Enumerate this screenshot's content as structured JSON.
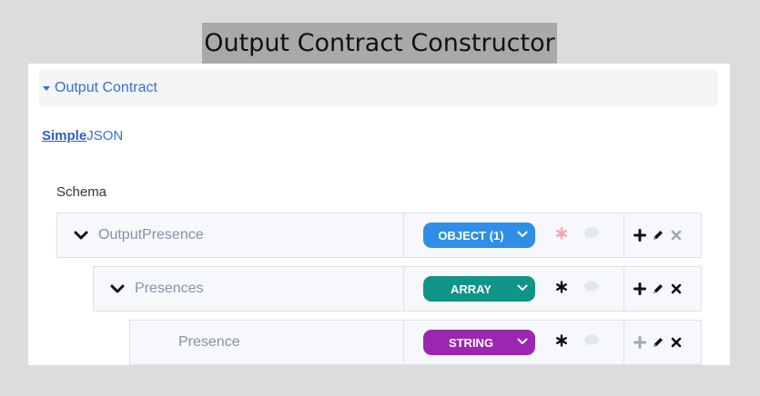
{
  "header": {
    "title": "Output Contract Constructor"
  },
  "accordion": {
    "label": "Output Contract"
  },
  "modes": [
    {
      "label": "Simple",
      "active": true
    },
    {
      "label": "JSON",
      "active": false
    }
  ],
  "schema": {
    "label": "Schema",
    "rows": [
      {
        "name": "OutputPresence",
        "type": "OBJECT (1)",
        "type_color": "#2f8ee8",
        "required": false,
        "add_enabled": true,
        "delete_enabled": false
      },
      {
        "name": "Presences",
        "type": "ARRAY",
        "type_color": "#0f9488",
        "required": true,
        "add_enabled": true,
        "delete_enabled": true
      },
      {
        "name": "Presence",
        "type": "STRING",
        "type_color": "#9b27b0",
        "required": true,
        "add_enabled": false,
        "delete_enabled": true
      }
    ]
  },
  "icons": {
    "expand": "chevron-down-icon",
    "required": "asterisk-icon",
    "comment": "comment-icon",
    "add": "plus-icon",
    "edit": "pencil-icon",
    "delete": "close-icon"
  }
}
